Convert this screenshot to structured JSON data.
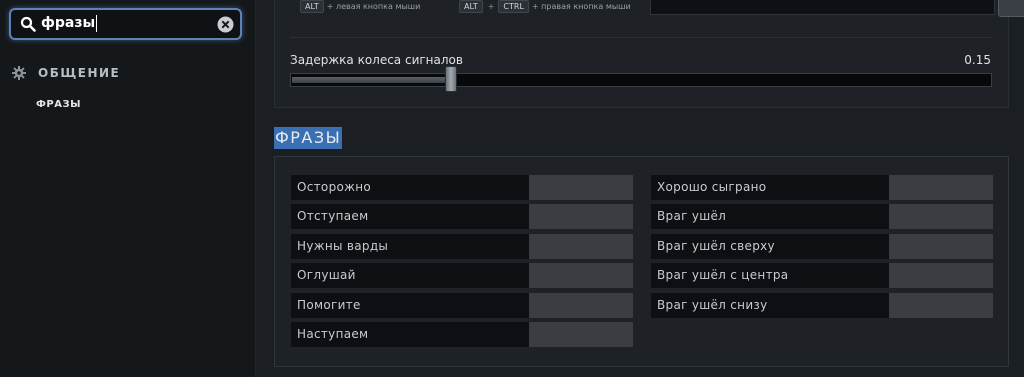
{
  "search": {
    "query": "фразы"
  },
  "sidebar": {
    "category": "ОБЩЕНИЕ",
    "subitem": "ФРАЗЫ"
  },
  "hotkeys": {
    "left": {
      "key": "ALT",
      "text": "+ левая кнопка мыши"
    },
    "right": {
      "key1": "ALT",
      "plus": "+",
      "key2": "CTRL",
      "text": "+ правая кнопка мыши"
    }
  },
  "slider": {
    "label": "Задержка колеса сигналов",
    "value_text": "0.15",
    "fraction": 0.225
  },
  "section": {
    "title": "ФРАЗЫ"
  },
  "phrases": {
    "left": [
      "Осторожно",
      "Отступаем",
      "Нужны варды",
      "Оглушай",
      "Помогите",
      "Наступаем"
    ],
    "right": [
      "Хорошо сыграно",
      "Враг ушёл",
      "Враг ушёл сверху",
      "Враг ушёл с центра",
      "Враг ушёл снизу"
    ]
  },
  "colors": {
    "accent": "#3b6fb3",
    "search_border": "#5b83b8"
  }
}
